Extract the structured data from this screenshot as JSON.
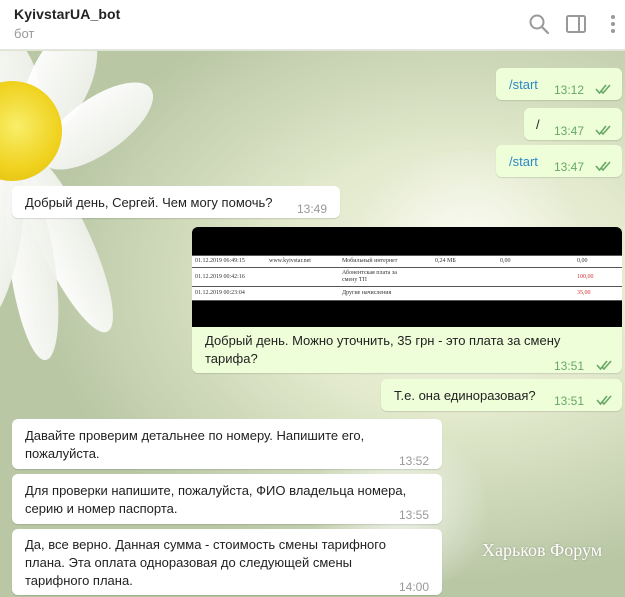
{
  "header": {
    "bot_name": "KyivstarUA_bot",
    "status": "бот",
    "icons": [
      "search-icon",
      "sidebar-panel-icon",
      "more-vertical-icon"
    ]
  },
  "messages": [
    {
      "text": "/start",
      "time": "13:12",
      "direction": "out",
      "read": true
    },
    {
      "text": "/",
      "time": "13:47",
      "direction": "out",
      "read": true
    },
    {
      "text": "/start",
      "time": "13:47",
      "direction": "out",
      "read": true
    },
    {
      "text": "Добрый день, Сергей. Чем могу помочь?",
      "time": "13:49",
      "direction": "in"
    },
    {
      "text_line1": "Добрый день. Можно уточнить, 35 грн - это плата за смену",
      "text_line2": "тарифа?",
      "time": "13:51",
      "direction": "out",
      "read": true
    },
    {
      "text": "Т.е. она единоразовая?",
      "time": "13:51",
      "direction": "out",
      "read": true
    },
    {
      "text_line1": "Давайте проверим детальнее по номеру. Напишите его,",
      "text_line2": "пожалуйста.",
      "time": "13:52",
      "direction": "in"
    },
    {
      "text_line1": "Для проверки напишите, пожалуйста, ФИО владельца номера,",
      "text_line2": "серию и номер паспорта.",
      "time": "13:55",
      "direction": "in"
    },
    {
      "text_line1": "Да, все верно. Данная сумма - стоимость смены тарифного",
      "text_line2": "плана. Эта оплата одноразовая до следующей смены",
      "text_line3": "тарифного плана.",
      "time": "14:00",
      "direction": "in"
    }
  ],
  "statement": {
    "rows": [
      {
        "date": "01.12.2019 06:49:15",
        "site": "www.kyivstar.net",
        "service": "Мобильный интернет",
        "volume": "0,24 МБ",
        "c1": "0,00",
        "c2": "0,00"
      },
      {
        "date": "01.12.2019 00:42:16",
        "site": "",
        "service_line1": "Абонентская плата за",
        "service_line2": "смену ТП",
        "volume": "",
        "c1": "",
        "c2": "100,00"
      },
      {
        "date": "01.12.2019 00:23:04",
        "site": "",
        "service": "Другие начисления",
        "volume": "",
        "c1": "",
        "c2": "35,00"
      }
    ]
  },
  "watermark": "Харьков Форум",
  "colors": {
    "outgoing": "#eefed9",
    "incoming": "#ffffff",
    "link": "#2c88c7",
    "check": "#68a766"
  }
}
